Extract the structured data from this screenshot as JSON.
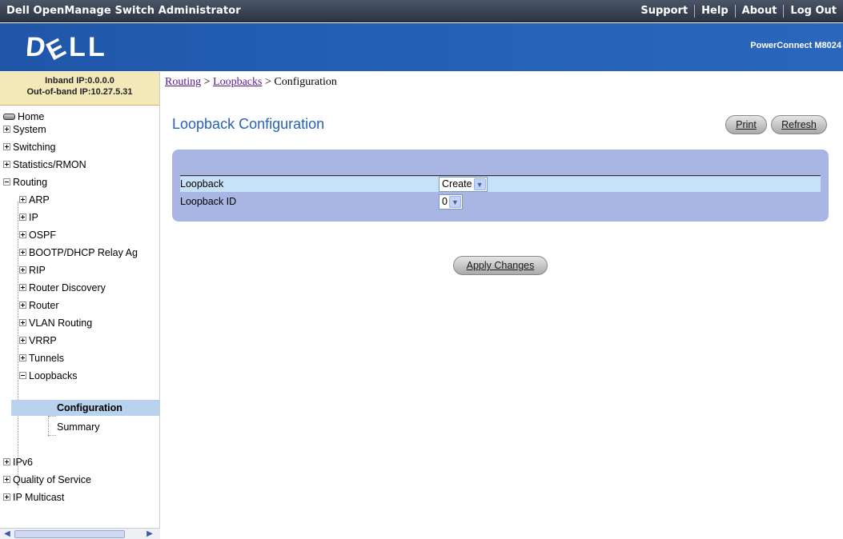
{
  "window": {
    "app_title": "Dell OpenManage Switch Administrator",
    "top_links": [
      "Support",
      "Help",
      "About",
      "Log Out"
    ]
  },
  "banner": {
    "logo_text": "DELL",
    "product": "PowerConnect M8024"
  },
  "sidebar": {
    "inband_ip": "Inband IP:0.0.0.0",
    "outofband_ip": "Out-of-band IP:10.27.5.31",
    "tree": {
      "home": "Home",
      "system": "System",
      "switching": "Switching",
      "statistics": "Statistics/RMON",
      "routing": "Routing",
      "arp": "ARP",
      "ip": "IP",
      "ospf": "OSPF",
      "bootp": "BOOTP/DHCP Relay Ag",
      "rip": "RIP",
      "router_discovery": "Router Discovery",
      "router": "Router",
      "vlan_routing": "VLAN Routing",
      "vrrp": "VRRP",
      "tunnels": "Tunnels",
      "loopbacks": "Loopbacks",
      "configuration": "Configuration",
      "summary": "Summary",
      "ipv6": "IPv6",
      "qos": "Quality of Service",
      "ip_multicast": "IP Multicast"
    }
  },
  "breadcrumb": {
    "part1": "Routing",
    "sep1": " > ",
    "part2": "Loopbacks",
    "sep2": " > ",
    "part3": "Configuration"
  },
  "main": {
    "title": "Loopback Configuration",
    "print_label": "Print",
    "refresh_label": "Refresh",
    "loopback_label": "Loopback",
    "loopback_value": "Create",
    "loopback_id_label": "Loopback ID",
    "loopback_id_value": "0",
    "apply_label": "Apply Changes"
  },
  "colors": {
    "title_blue": "#2961b5",
    "banner_blue": "#245fb4",
    "panel": "#a9b6e3",
    "selected_row": "#b9d2ee"
  },
  "icons": [
    "drive-icon",
    "plus-box-icon",
    "minus-box-icon",
    "chevron-down-icon",
    "scroll-left-icon",
    "scroll-right-icon"
  ]
}
